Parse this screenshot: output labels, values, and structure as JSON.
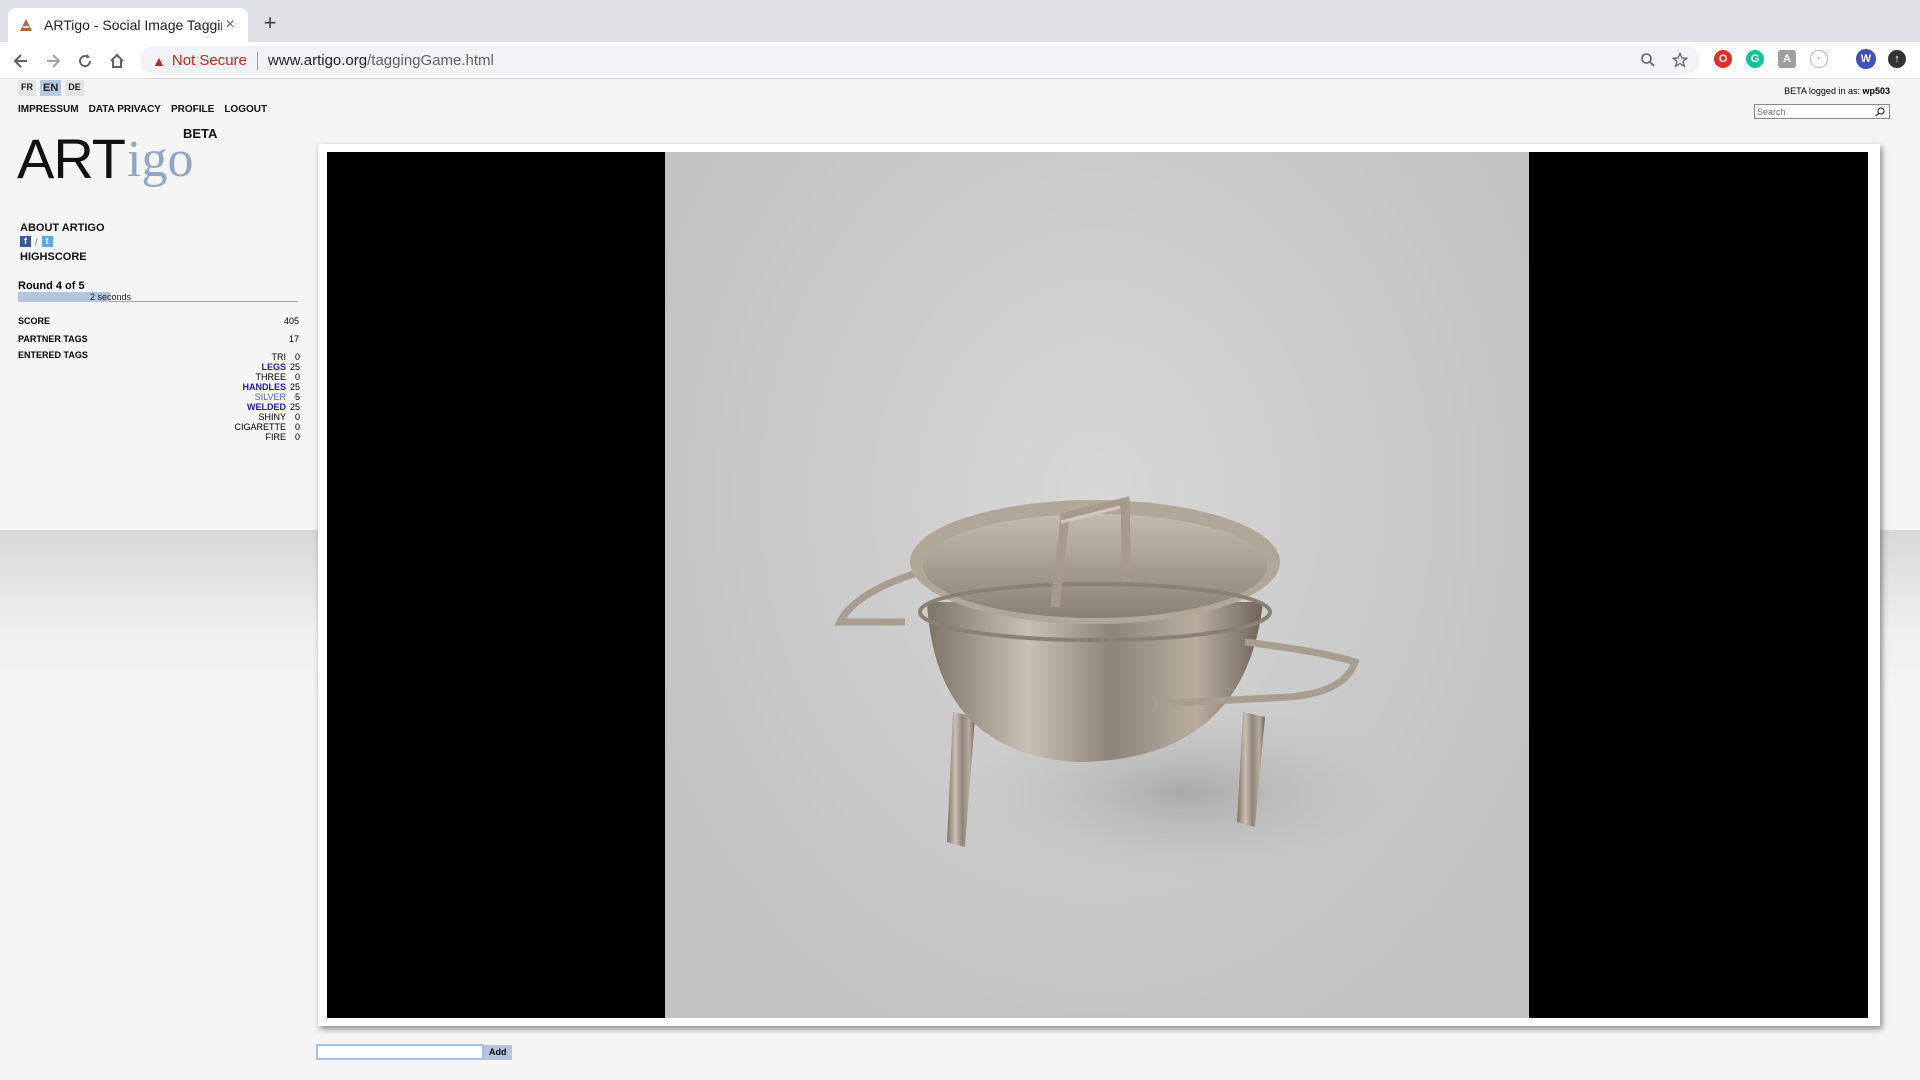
{
  "browser": {
    "tab_title": "ARTigo - Social Image Tagging",
    "tab_close": "×",
    "new_tab": "+",
    "security_label": "Not Secure",
    "url_host": "www.artigo.org",
    "url_path": "/taggingGame.html",
    "profile_initial": "W"
  },
  "page": {
    "languages": [
      "FR",
      "EN",
      "DE"
    ],
    "active_language": "EN",
    "top_nav": [
      "IMPRESSUM",
      "DATA PRIVACY",
      "PROFILE",
      "LOGOUT"
    ],
    "logo": {
      "art": "ART",
      "igo": "igo",
      "beta": "BETA"
    },
    "side_menu": {
      "about": "ABOUT ARTIGO",
      "highscore": "HIGHSCORE"
    },
    "social": {
      "facebook": "f",
      "twitter": "t",
      "separator": "/"
    },
    "round_label": "Round 4 of 5",
    "timer": {
      "text": "2 seconds",
      "fraction": 0.33
    },
    "stats": {
      "score_label": "SCORE",
      "score_value": "405",
      "partner_label": "PARTNER TAGS",
      "partner_value": "17",
      "entered_label": "ENTERED TAGS"
    },
    "entered_tags": [
      {
        "name": "TRI",
        "points": "0",
        "kind": "none"
      },
      {
        "name": "LEGS",
        "points": "25",
        "kind": "match"
      },
      {
        "name": "THREE",
        "points": "0",
        "kind": "none"
      },
      {
        "name": "HANDLES",
        "points": "25",
        "kind": "match"
      },
      {
        "name": "SILVER",
        "points": "5",
        "kind": "low"
      },
      {
        "name": "WELDED",
        "points": "25",
        "kind": "match"
      },
      {
        "name": "SHINY",
        "points": "0",
        "kind": "none"
      },
      {
        "name": "CIGARETTE",
        "points": "0",
        "kind": "none"
      },
      {
        "name": "FIRE",
        "points": "0",
        "kind": "none"
      }
    ],
    "user": {
      "prefix": "BETA logged in as:",
      "name": "wp503"
    },
    "search": {
      "placeholder": "Search"
    },
    "tag_input": {
      "value": "",
      "add_label": "Add"
    }
  },
  "colors": {
    "accent": "#b5c3de",
    "match_tag": "#1a1ab8",
    "low_tag": "#4f5fd0",
    "warning": "#c5221f"
  }
}
